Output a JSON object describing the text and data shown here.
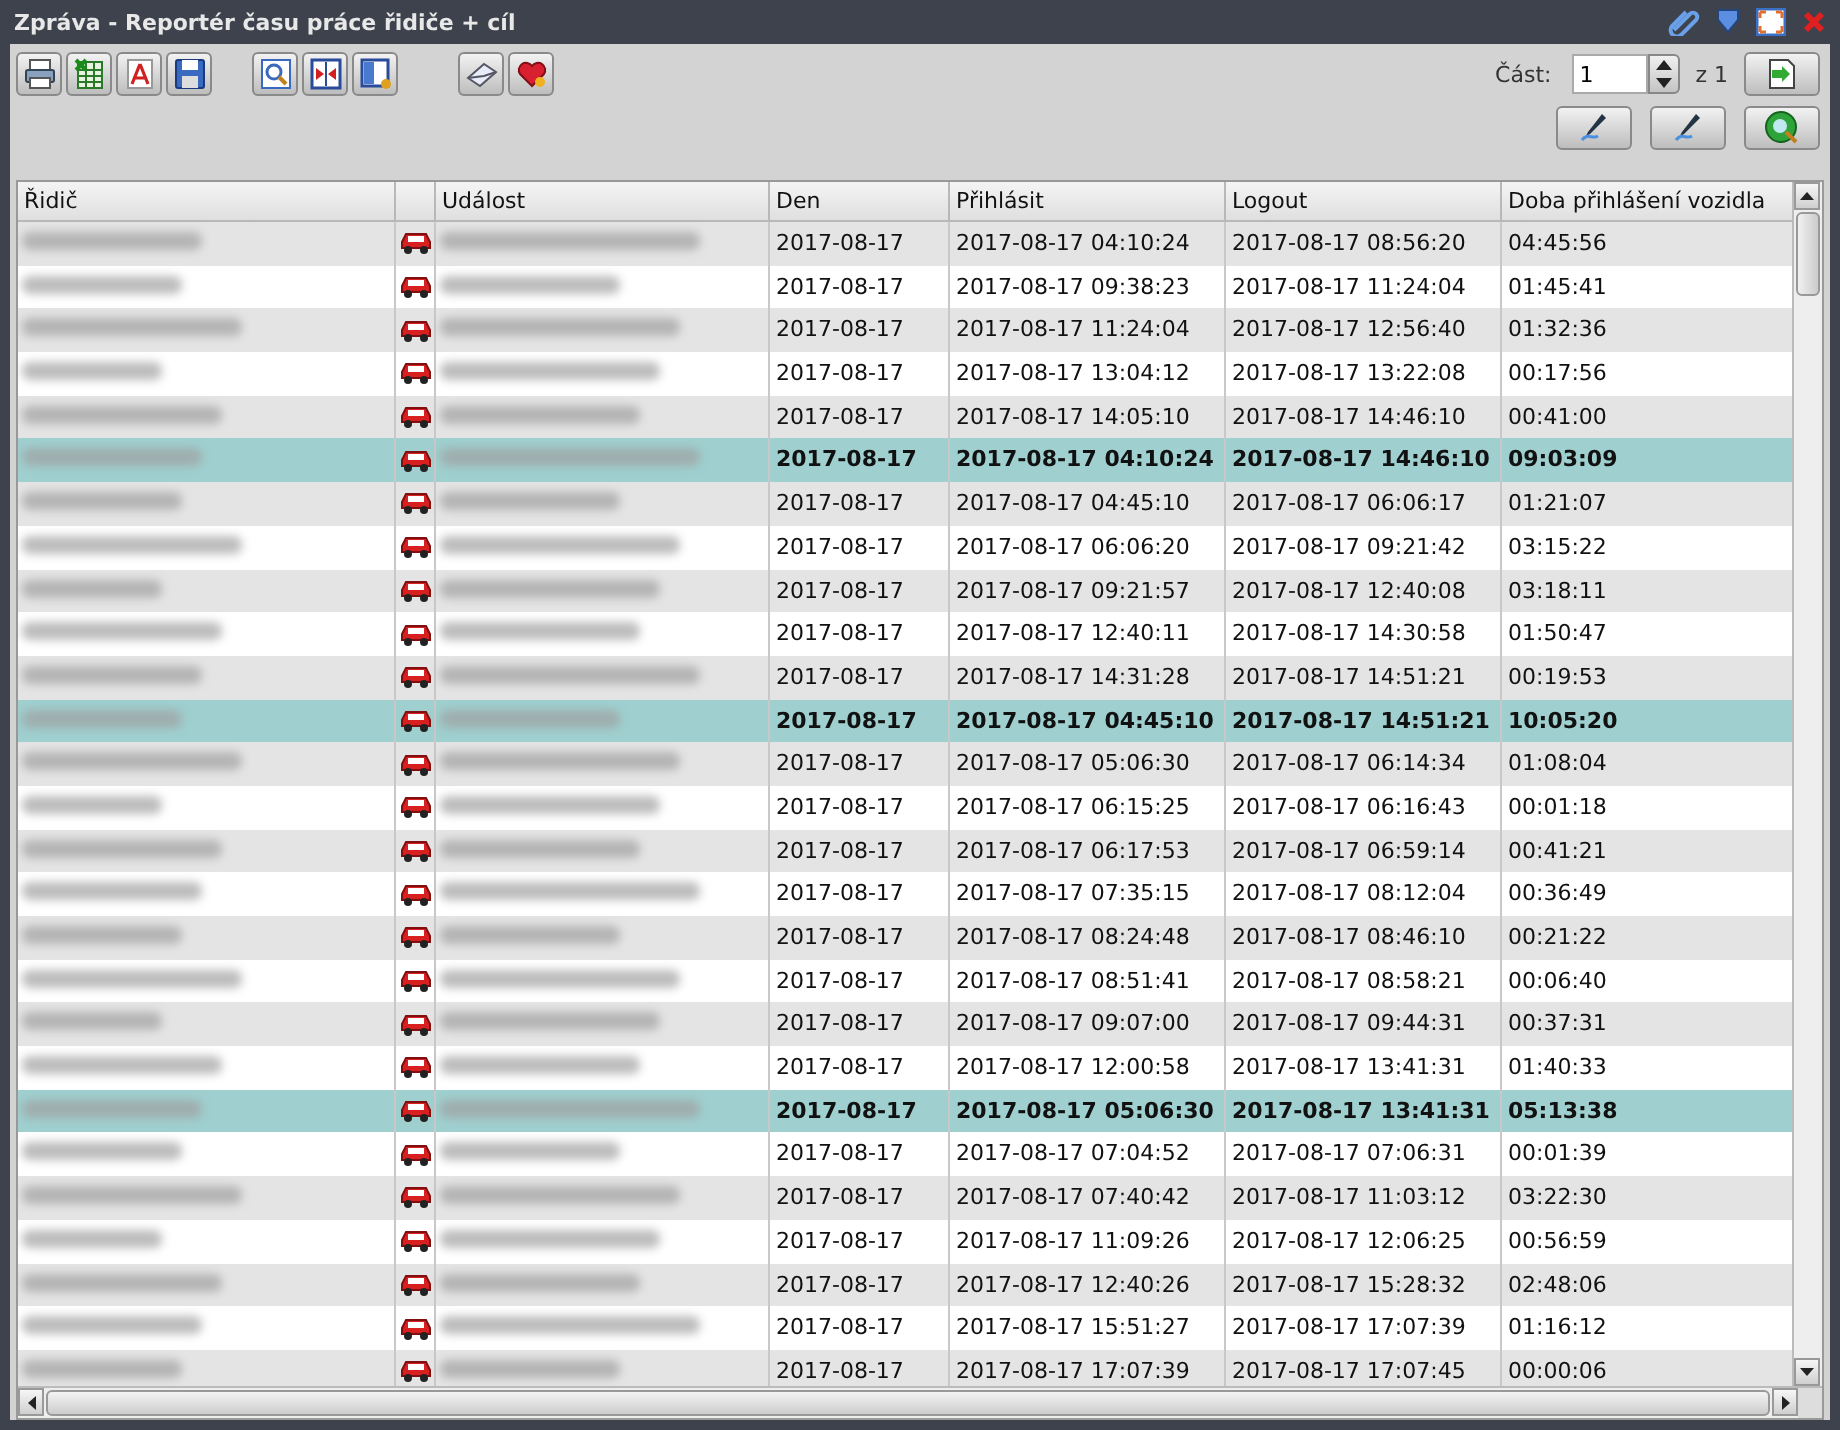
{
  "window": {
    "title": "Zpráva - Reportér času práce řidiče + cíl"
  },
  "pager": {
    "label": "Část:",
    "value": "1",
    "total": "z 1"
  },
  "table": {
    "columns": [
      "Řidič",
      "",
      "Událost",
      "Den",
      "Přihlásit",
      "Logout",
      "Doba přihlášení vozidla"
    ],
    "rows": [
      {
        "kind": "entry",
        "den": "2017-08-17",
        "login": "2017-08-17 04:10:24",
        "logout": "2017-08-17 08:56:20",
        "duration": "04:45:56"
      },
      {
        "kind": "entry",
        "den": "2017-08-17",
        "login": "2017-08-17 09:38:23",
        "logout": "2017-08-17 11:24:04",
        "duration": "01:45:41"
      },
      {
        "kind": "entry",
        "den": "2017-08-17",
        "login": "2017-08-17 11:24:04",
        "logout": "2017-08-17 12:56:40",
        "duration": "01:32:36"
      },
      {
        "kind": "entry",
        "den": "2017-08-17",
        "login": "2017-08-17 13:04:12",
        "logout": "2017-08-17 13:22:08",
        "duration": "00:17:56"
      },
      {
        "kind": "entry",
        "den": "2017-08-17",
        "login": "2017-08-17 14:05:10",
        "logout": "2017-08-17 14:46:10",
        "duration": "00:41:00"
      },
      {
        "kind": "total",
        "den": "2017-08-17",
        "login": "2017-08-17 04:10:24",
        "logout": "2017-08-17 14:46:10",
        "duration": "09:03:09"
      },
      {
        "kind": "entry",
        "den": "2017-08-17",
        "login": "2017-08-17 04:45:10",
        "logout": "2017-08-17 06:06:17",
        "duration": "01:21:07"
      },
      {
        "kind": "entry",
        "den": "2017-08-17",
        "login": "2017-08-17 06:06:20",
        "logout": "2017-08-17 09:21:42",
        "duration": "03:15:22"
      },
      {
        "kind": "entry",
        "den": "2017-08-17",
        "login": "2017-08-17 09:21:57",
        "logout": "2017-08-17 12:40:08",
        "duration": "03:18:11"
      },
      {
        "kind": "entry",
        "den": "2017-08-17",
        "login": "2017-08-17 12:40:11",
        "logout": "2017-08-17 14:30:58",
        "duration": "01:50:47"
      },
      {
        "kind": "entry",
        "den": "2017-08-17",
        "login": "2017-08-17 14:31:28",
        "logout": "2017-08-17 14:51:21",
        "duration": "00:19:53"
      },
      {
        "kind": "total",
        "den": "2017-08-17",
        "login": "2017-08-17 04:45:10",
        "logout": "2017-08-17 14:51:21",
        "duration": "10:05:20"
      },
      {
        "kind": "entry",
        "den": "2017-08-17",
        "login": "2017-08-17 05:06:30",
        "logout": "2017-08-17 06:14:34",
        "duration": "01:08:04"
      },
      {
        "kind": "entry",
        "den": "2017-08-17",
        "login": "2017-08-17 06:15:25",
        "logout": "2017-08-17 06:16:43",
        "duration": "00:01:18"
      },
      {
        "kind": "entry",
        "den": "2017-08-17",
        "login": "2017-08-17 06:17:53",
        "logout": "2017-08-17 06:59:14",
        "duration": "00:41:21"
      },
      {
        "kind": "entry",
        "den": "2017-08-17",
        "login": "2017-08-17 07:35:15",
        "logout": "2017-08-17 08:12:04",
        "duration": "00:36:49"
      },
      {
        "kind": "entry",
        "den": "2017-08-17",
        "login": "2017-08-17 08:24:48",
        "logout": "2017-08-17 08:46:10",
        "duration": "00:21:22"
      },
      {
        "kind": "entry",
        "den": "2017-08-17",
        "login": "2017-08-17 08:51:41",
        "logout": "2017-08-17 08:58:21",
        "duration": "00:06:40"
      },
      {
        "kind": "entry",
        "den": "2017-08-17",
        "login": "2017-08-17 09:07:00",
        "logout": "2017-08-17 09:44:31",
        "duration": "00:37:31"
      },
      {
        "kind": "entry",
        "den": "2017-08-17",
        "login": "2017-08-17 12:00:58",
        "logout": "2017-08-17 13:41:31",
        "duration": "01:40:33"
      },
      {
        "kind": "total",
        "den": "2017-08-17",
        "login": "2017-08-17 05:06:30",
        "logout": "2017-08-17 13:41:31",
        "duration": "05:13:38"
      },
      {
        "kind": "entry",
        "den": "2017-08-17",
        "login": "2017-08-17 07:04:52",
        "logout": "2017-08-17 07:06:31",
        "duration": "00:01:39"
      },
      {
        "kind": "entry",
        "den": "2017-08-17",
        "login": "2017-08-17 07:40:42",
        "logout": "2017-08-17 11:03:12",
        "duration": "03:22:30"
      },
      {
        "kind": "entry",
        "den": "2017-08-17",
        "login": "2017-08-17 11:09:26",
        "logout": "2017-08-17 12:06:25",
        "duration": "00:56:59"
      },
      {
        "kind": "entry",
        "den": "2017-08-17",
        "login": "2017-08-17 12:40:26",
        "logout": "2017-08-17 15:28:32",
        "duration": "02:48:06"
      },
      {
        "kind": "entry",
        "den": "2017-08-17",
        "login": "2017-08-17 15:51:27",
        "logout": "2017-08-17 17:07:39",
        "duration": "01:16:12"
      },
      {
        "kind": "entry",
        "den": "2017-08-17",
        "login": "2017-08-17 17:07:39",
        "logout": "2017-08-17 17:07:45",
        "duration": "00:00:06"
      }
    ]
  }
}
